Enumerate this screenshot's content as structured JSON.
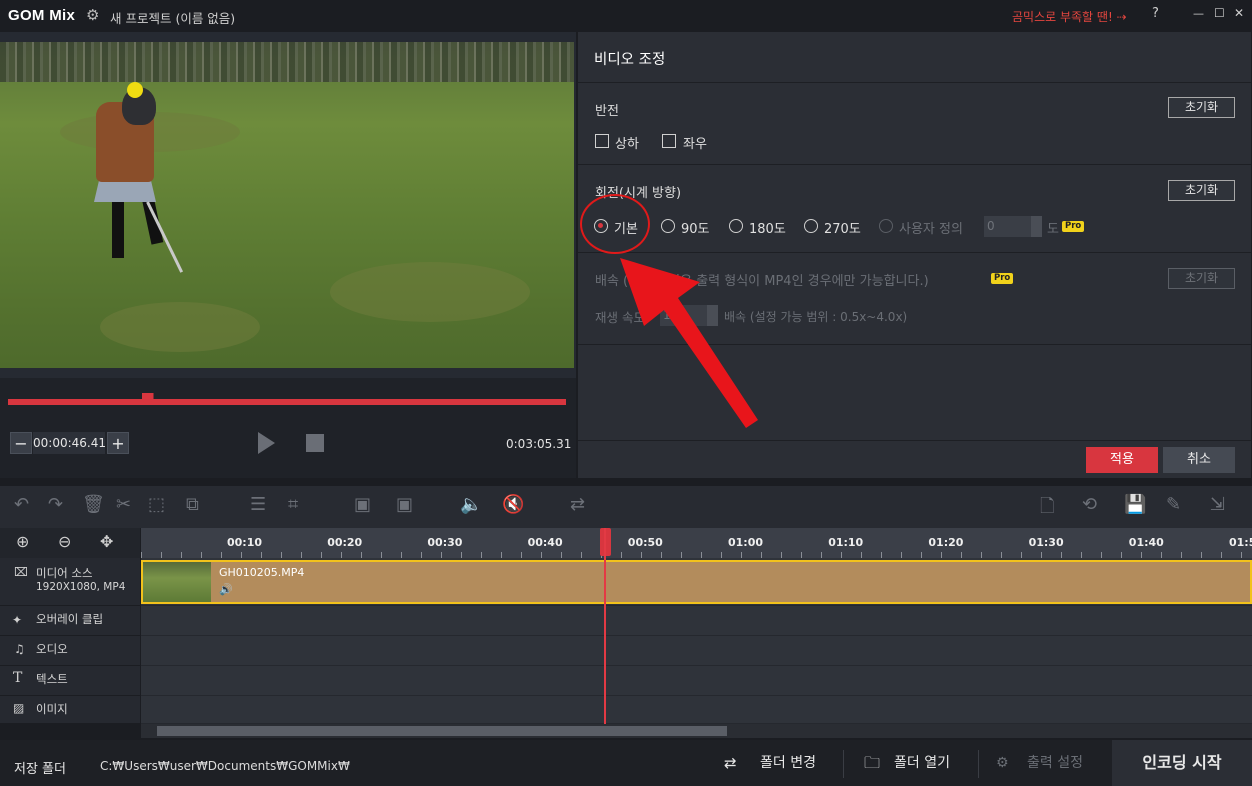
{
  "titlebar": {
    "app_name": "GOM Mix",
    "project_name": "새 프로젝트 (이름 없음)",
    "promo": "곰믹스로 부족할 땐! ⇢",
    "help": "?",
    "minimize": "—",
    "maximize": "☐",
    "close": "✕"
  },
  "preview": {
    "current_time": "00:00:46.41",
    "duration": "0:03:05.31",
    "seek_progress": 0.25
  },
  "panel": {
    "title": "비디오 조정",
    "flip": {
      "label": "반전",
      "reset": "초기화",
      "options": [
        "상하",
        "좌우"
      ]
    },
    "rotate": {
      "label": "회전(시계 방향)",
      "reset": "초기화",
      "options": [
        "기본",
        "90도",
        "180도",
        "270도",
        "사용자 정의"
      ],
      "selected": "기본",
      "custom_value": "0",
      "unit": "도",
      "badge": "Pro"
    },
    "speed": {
      "label": "배속 (배속 설정은 출력 형식이 MP4인 경우에만 가능합니다.)",
      "reset": "초기화",
      "badge": "Pro",
      "row_label": "재생 속도",
      "value": "1.0",
      "hint": "배속 (설정 가능 범위 : 0.5x~4.0x)"
    },
    "apply": "적용",
    "cancel": "취소"
  },
  "timeline": {
    "ruler": [
      "00:10",
      "00:20",
      "00:30",
      "00:40",
      "00:50",
      "01:00",
      "01:10",
      "01:20",
      "01:30",
      "01:40",
      "01:50"
    ],
    "tracks": [
      {
        "label": "미디어 소스",
        "sub": "1920X1080, MP4"
      },
      {
        "label": "오버레이 클립"
      },
      {
        "label": "오디오"
      },
      {
        "label": "텍스트"
      },
      {
        "label": "이미지"
      }
    ],
    "clip": {
      "name": "GH010205.MP4",
      "audio_icon": "🔊"
    }
  },
  "bottom": {
    "save_label": "저장 폴더",
    "save_path": "C:₩Users₩user₩Documents₩GOMMix₩",
    "change_folder": "폴더 변경",
    "open_folder": "폴더 열기",
    "output_settings": "출력 설정",
    "encode": "인코딩 시작"
  }
}
